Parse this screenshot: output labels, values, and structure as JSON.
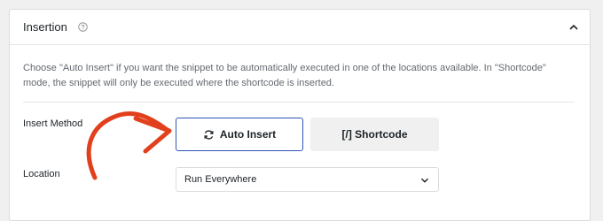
{
  "panel": {
    "title": "Insertion",
    "description": "Choose \"Auto Insert\" if you want the snippet to be automatically executed in one of the locations available. In \"Shortcode\" mode, the snippet will only be executed where the shortcode is inserted."
  },
  "insert_method": {
    "label": "Insert Method",
    "auto_insert_label": "Auto Insert",
    "shortcode_label": "[/] Shortcode",
    "selected": "Auto Insert"
  },
  "location": {
    "label": "Location",
    "selected_value": "Run Everywhere"
  },
  "colors": {
    "accent": "#2f54b5",
    "arrow": "#e2401c"
  },
  "icons": {
    "help": "question-circle-icon",
    "collapse": "chevron-up-icon",
    "auto_insert": "refresh-icon",
    "select": "chevron-down-icon"
  }
}
